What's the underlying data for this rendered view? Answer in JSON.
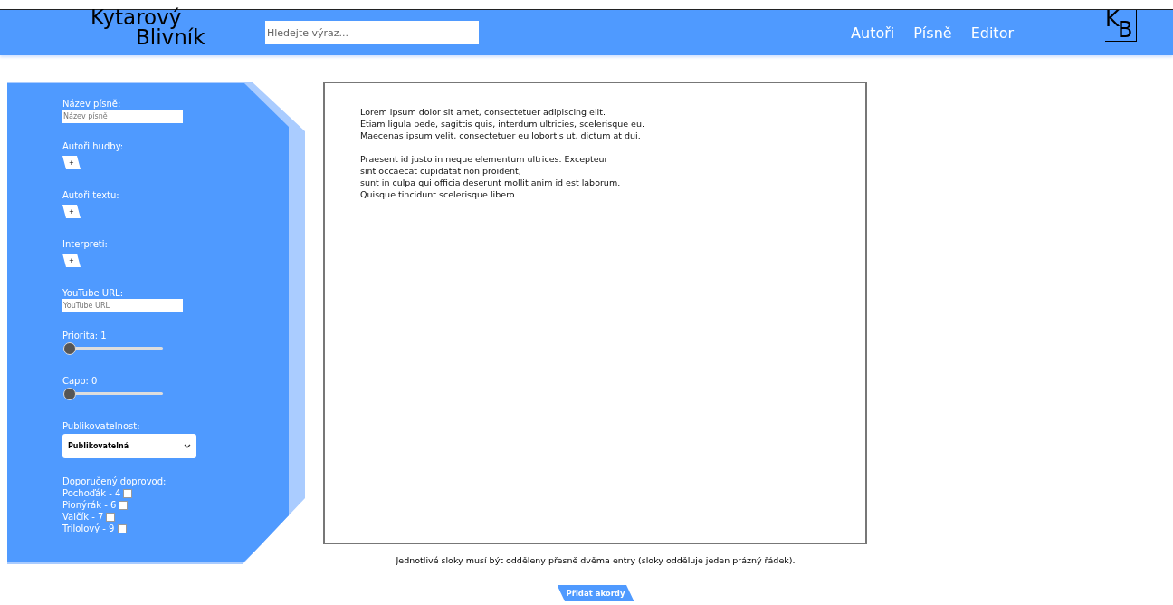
{
  "header": {
    "logo_line_1": "Kytarový",
    "logo_line_2": "Blivník",
    "search": {
      "placeholder": "Hledejte výraz..."
    },
    "nav": [
      {
        "label": "Autoři"
      },
      {
        "label": "Písně"
      },
      {
        "label": "Editor"
      }
    ],
    "badge_letters": [
      "K",
      "B"
    ]
  },
  "sidebar": {
    "fields": [
      {
        "kind": "text",
        "label": "Název písně:",
        "placeholder": "Název písně"
      },
      {
        "kind": "add",
        "label": "Autoři hudby:",
        "button": "+"
      },
      {
        "kind": "add",
        "label": "Autoři textu:",
        "button": "+"
      },
      {
        "kind": "add",
        "label": "Interpreti:",
        "button": "+"
      },
      {
        "kind": "text",
        "label": "YouTube URL:",
        "placeholder": "YouTube URL"
      },
      {
        "kind": "slider",
        "label": "Priorita: 1",
        "level": 0
      },
      {
        "kind": "slider",
        "label": "Capo: 0",
        "level": 0
      },
      {
        "kind": "select",
        "label": "Publikovatelnost:",
        "value": "Publikovatelná"
      },
      {
        "kind": "checks",
        "label": "Doporučený doprovod:",
        "options": [
          {
            "label": "Pochoďák - 4",
            "checked": false
          },
          {
            "label": "Pionýrák - 6",
            "checked": false
          },
          {
            "label": "Valčík - 7",
            "checked": false
          },
          {
            "label": "Trilolový - 9",
            "checked": false
          }
        ]
      }
    ]
  },
  "editor": {
    "paragraphs": [
      [
        "Lorem ipsum dolor sit amet, consectetuer adipiscing elit.",
        "Etiam ligula pede, sagittis quis, interdum ultricies, scelerisque eu.",
        "Maecenas ipsum velit, consectetuer eu lobortis ut, dictum at dui."
      ],
      [
        "Praesent id justo in neque elementum ultrices. Excepteur",
        "sint occaecat cupidatat non proident,",
        "sunt in culpa qui officia deserunt mollit anim id est laborum.",
        "Quisque tincidunt scelerisque libero."
      ]
    ]
  },
  "note": "Jednotlivé sloky musí být odděleny přesně dvěma entry (sloky odděluje jeden prázný řádek).",
  "add_chords_button": "Přidat akordy"
}
